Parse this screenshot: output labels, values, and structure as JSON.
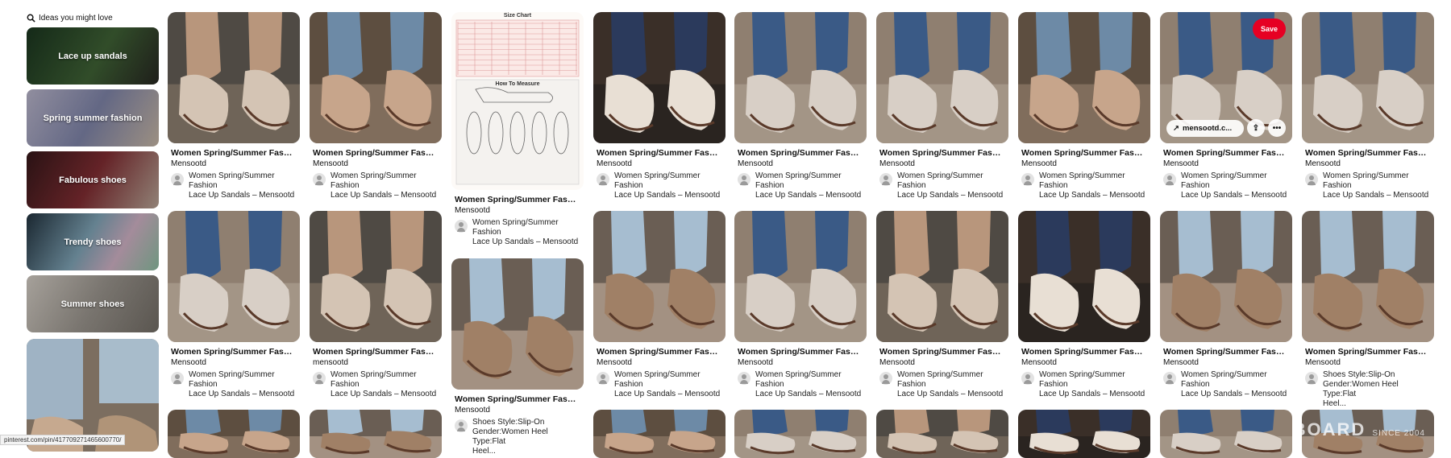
{
  "ideas": {
    "title": "Ideas you might love",
    "tiles": [
      {
        "label": "Lace up sandals",
        "color": "#2f4a2c"
      },
      {
        "label": "Spring summer fashion",
        "color": "#8c8eb3"
      },
      {
        "label": "Fabulous shoes",
        "color": "#6b2a2e"
      },
      {
        "label": "Trendy shoes",
        "color": "#6c8fa5"
      },
      {
        "label": "Summer shoes",
        "color": "#b3aaa0"
      }
    ]
  },
  "pin_text": {
    "title": "Women Spring/Summer Fashion...",
    "source": "Mensootd",
    "source_lower": "mensootd",
    "desc_line1": "Women Spring/Summer Fashion",
    "desc_line2": "Lace Up Sandals – Mensootd",
    "alt_desc_line1": "Shoes Style:Slip-On",
    "alt_desc_line2": "Gender:Women Heel Type:Flat",
    "alt_desc_line3": "Heel...",
    "size_chart_title": "Size Chart",
    "measure_title": "How To Measure"
  },
  "hover": {
    "save_label": "Save",
    "link_label": "mensootd.c...",
    "share_icon": "share-icon",
    "more_icon": "more-icon"
  },
  "status_url": "pinterest.com/pin/417709271465600770/",
  "watermark": {
    "main": "BOARD",
    "sub": "SINCE 2004"
  },
  "colors": {
    "save": "#e60023",
    "accent": "#111111"
  }
}
